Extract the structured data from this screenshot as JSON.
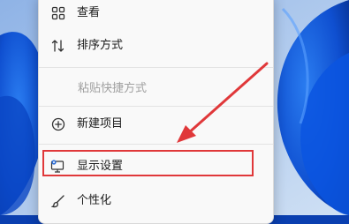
{
  "context_menu": {
    "items": [
      {
        "label": "查看",
        "icon": "grid-icon"
      },
      {
        "label": "排序方式",
        "icon": "sort-icon"
      },
      {
        "label": "粘贴快捷方式",
        "icon": "",
        "disabled": true
      },
      {
        "label": "新建项目",
        "icon": "plus-circle-icon"
      },
      {
        "label": "显示设置",
        "icon": "display-settings-icon"
      },
      {
        "label": "个性化",
        "icon": "brush-icon"
      }
    ]
  },
  "annotation": {
    "highlight_color": "#e0383a",
    "highlighted_item": "显示设置"
  },
  "colors": {
    "wallpaper_blue": "#0a3fb0",
    "menu_background": "#f9f9f9"
  }
}
